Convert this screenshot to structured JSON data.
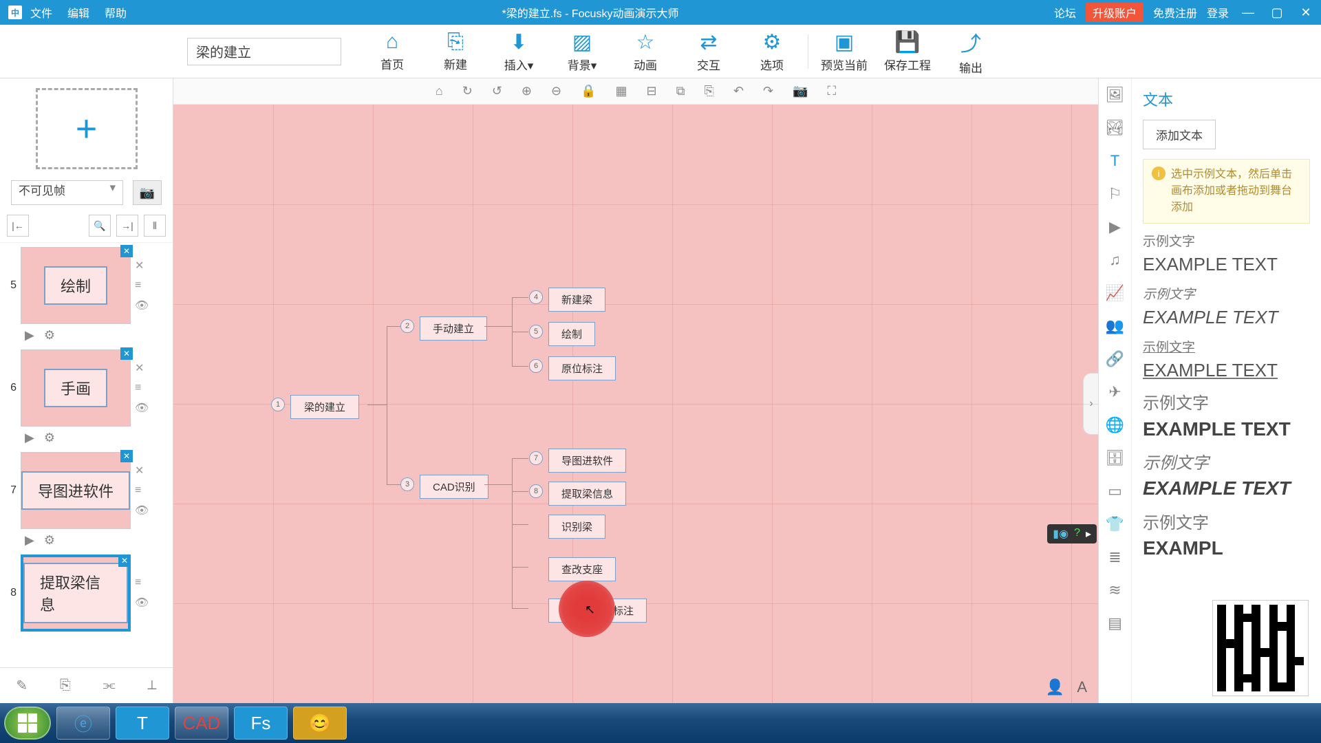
{
  "titlebar": {
    "menus": [
      "文件",
      "编辑",
      "帮助"
    ],
    "title": "*梁的建立.fs - Focusky动画演示大师",
    "right": {
      "forum": "论坛",
      "upgrade": "升级账户",
      "register": "免费注册",
      "login": "登录"
    }
  },
  "toolbar": {
    "title_value": "梁的建立",
    "buttons": {
      "home": "首页",
      "new": "新建",
      "insert": "插入",
      "background": "背景",
      "animation": "动画",
      "interact": "交互",
      "options": "选项",
      "preview": "预览当前",
      "save": "保存工程",
      "export": "输出"
    }
  },
  "left": {
    "visibility": "不可见帧",
    "thumbs": [
      {
        "num": "5",
        "label": "绘制"
      },
      {
        "num": "6",
        "label": "手画"
      },
      {
        "num": "7",
        "label": "导图进软件"
      },
      {
        "num": "8",
        "label": "提取梁信息",
        "selected": true
      }
    ]
  },
  "canvas": {
    "root": {
      "num": "1",
      "label": "梁的建立"
    },
    "branch_a": {
      "num": "2",
      "label": "手动建立"
    },
    "branch_b": {
      "num": "3",
      "label": "CAD识别"
    },
    "leaves_a": [
      {
        "num": "4",
        "label": "新建梁"
      },
      {
        "num": "5",
        "label": "绘制"
      },
      {
        "num": "6",
        "label": "原位标注"
      }
    ],
    "leaves_b": [
      {
        "num": "7",
        "label": "导图进软件"
      },
      {
        "num": "8",
        "label": "提取梁信息"
      },
      {
        "label": "识别梁"
      },
      {
        "label": "查改支座"
      },
      {
        "label": "识别梁原位标注"
      }
    ]
  },
  "right": {
    "title": "文本",
    "add_text": "添加文本",
    "hint": "选中示例文本，然后单击画布添加或者拖动到舞台添加",
    "sample_cn": "示例文字",
    "sample_en": "EXAMPLE TEXT",
    "sample_en_partial": "EXAMPL"
  }
}
